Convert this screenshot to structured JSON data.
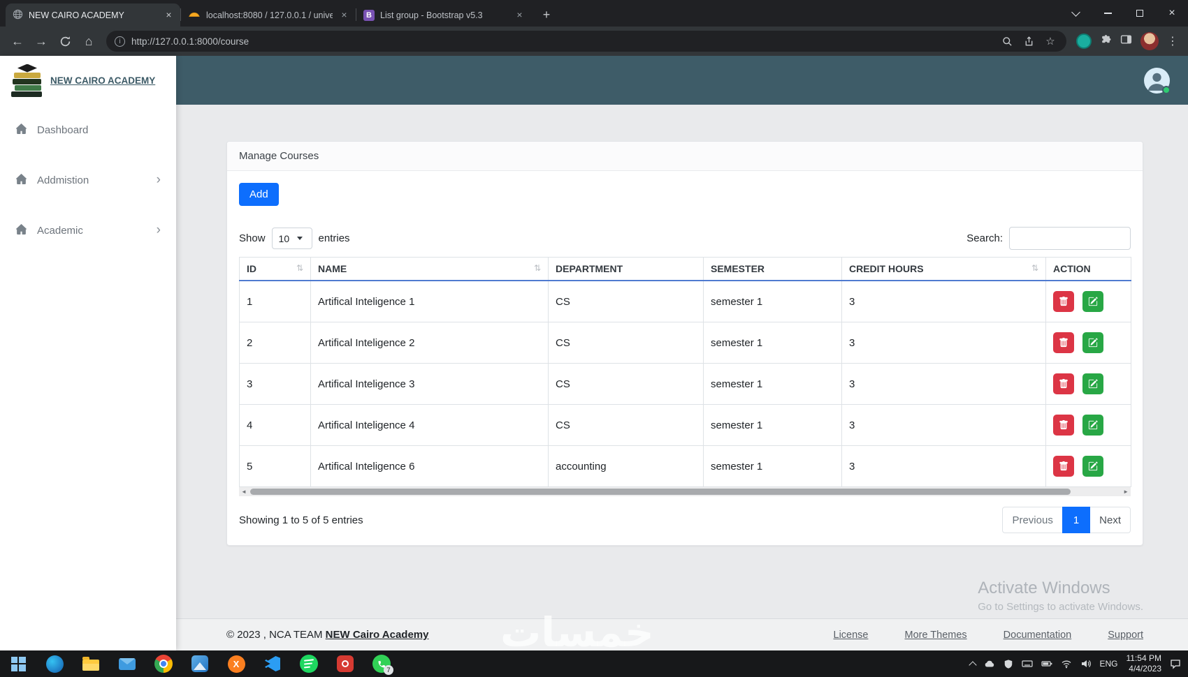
{
  "browser": {
    "tabs": [
      {
        "title": "NEW CAIRO ACADEMY"
      },
      {
        "title": "localhost:8080 / 127.0.0.1 / unive"
      },
      {
        "title": "List group - Bootstrap v5.3"
      }
    ],
    "url": "http://127.0.0.1:8000/course"
  },
  "icons": {
    "new_tab": "+",
    "close": "×",
    "back": "←",
    "forward": "→",
    "home": "⌂",
    "info": "i",
    "star": "☆",
    "kebab": "⋮",
    "sort": "⇅",
    "chevron_right": "›",
    "scroll_left": "◄",
    "scroll_right": "►",
    "bootstrap_b": "B",
    "xampp_x": "X"
  },
  "app": {
    "brand": "NEW CAIRO ACADEMY",
    "menu": [
      {
        "label": "Dashboard"
      },
      {
        "label": "Addmistion"
      },
      {
        "label": "Academic"
      }
    ]
  },
  "page": {
    "card_title": "Manage Courses",
    "add_button": "Add",
    "length": {
      "show": "Show",
      "value": "10",
      "entries": "entries"
    },
    "search_label": "Search:",
    "search_value": "",
    "table": {
      "headers": [
        "ID",
        "NAME",
        "DEPARTMENT",
        "SEMESTER",
        "CREDIT HOURS",
        "ACTION"
      ],
      "rows": [
        {
          "id": "1",
          "name": "Artifical Inteligence 1",
          "department": "CS",
          "semester": "semester 1",
          "credit": "3"
        },
        {
          "id": "2",
          "name": "Artifical Inteligence 2",
          "department": "CS",
          "semester": "semester 1",
          "credit": "3"
        },
        {
          "id": "3",
          "name": "Artifical Inteligence 3",
          "department": "CS",
          "semester": "semester 1",
          "credit": "3"
        },
        {
          "id": "4",
          "name": "Artifical Inteligence 4",
          "department": "CS",
          "semester": "semester 1",
          "credit": "3"
        },
        {
          "id": "5",
          "name": "Artifical Inteligence 6",
          "department": "accounting",
          "semester": "semester 1",
          "credit": "3"
        }
      ]
    },
    "info": "Showing 1 to 5 of 5 entries",
    "pagination": {
      "previous": "Previous",
      "current": "1",
      "next": "Next"
    }
  },
  "footer": {
    "copyright": "© 2023 , NCA TEAM",
    "brand_link": "NEW Cairo Academy",
    "links": [
      "License",
      "More Themes",
      "Documentation",
      "Support"
    ]
  },
  "watermarks": {
    "activate_title": "Activate Windows",
    "activate_sub": "Go to Settings to activate Windows.",
    "site": "خمسات"
  },
  "taskbar": {
    "language": "ENG",
    "time": "11:54 PM",
    "date": "4/4/2023",
    "whatsapp_badge": "7"
  },
  "colors": {
    "accent": "#0d6efd",
    "header": "#3e5c68",
    "danger": "#dc3545",
    "success": "#28a745"
  }
}
